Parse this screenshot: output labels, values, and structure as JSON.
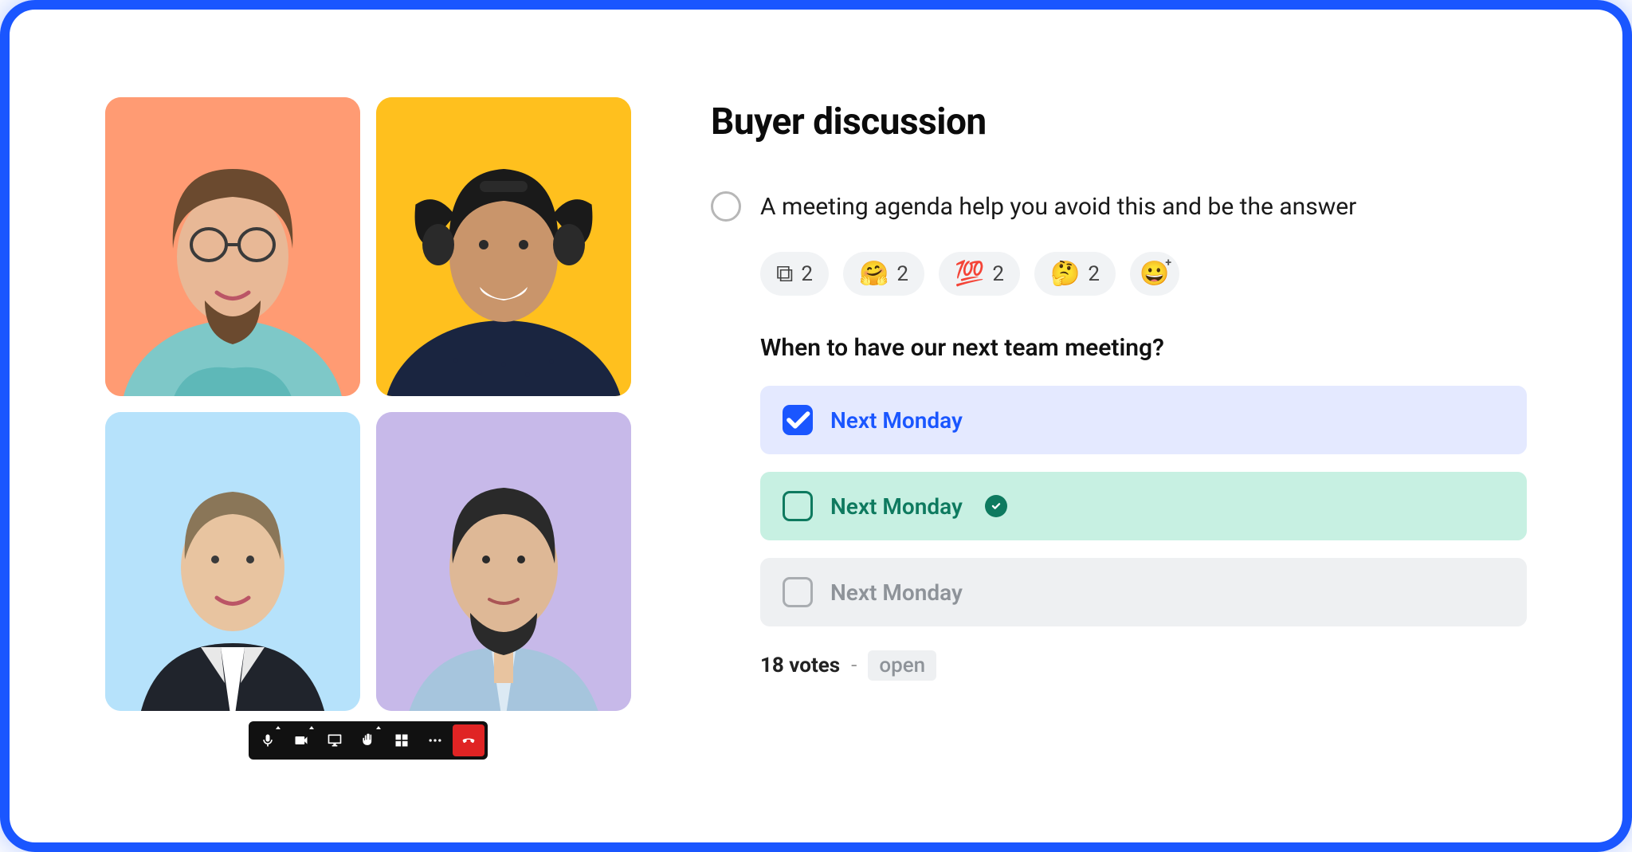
{
  "panel": {
    "title": "Buyer discussion",
    "agenda_text": "A meeting agenda help you avoid this and be the answer",
    "poll_question": "When to have our next team meeting?"
  },
  "reactions": [
    {
      "icon": "copy-icon",
      "emoji": "⧉",
      "count": 2
    },
    {
      "icon": "hug-emoji",
      "emoji": "🤗",
      "count": 2
    },
    {
      "icon": "hundred-emoji",
      "emoji": "💯",
      "count": 2
    },
    {
      "icon": "thinking-emoji",
      "emoji": "🤔",
      "count": 2
    }
  ],
  "add_reaction_emoji": "😀",
  "poll_options": [
    {
      "label": "Next Monday",
      "state": "selected"
    },
    {
      "label": "Next Monday",
      "state": "winner"
    },
    {
      "label": "Next Monday",
      "state": "default"
    }
  ],
  "votes": {
    "count_label": "18 votes",
    "status": "open"
  },
  "participants": [
    {
      "bg": "bg-orange"
    },
    {
      "bg": "bg-yellow"
    },
    {
      "bg": "bg-blue"
    },
    {
      "bg": "bg-purple"
    }
  ],
  "toolbar_icons": [
    "mic",
    "camera",
    "screenshare",
    "raise-hand",
    "grid",
    "more",
    "end-call"
  ]
}
